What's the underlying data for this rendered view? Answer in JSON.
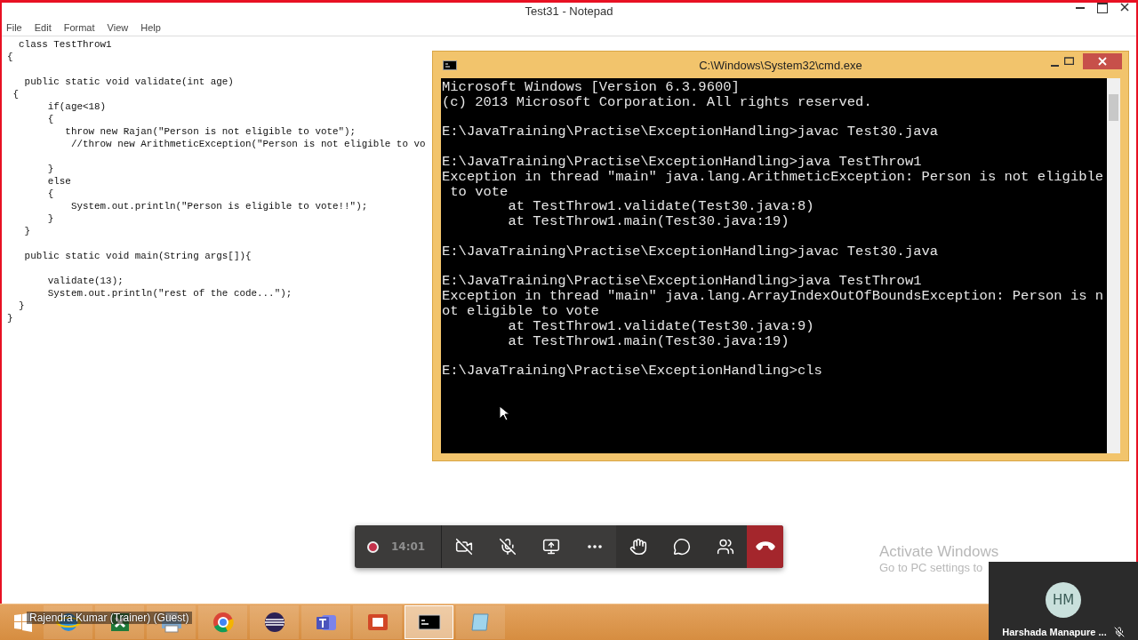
{
  "notepad": {
    "title": "Test31 - Notepad",
    "menu": [
      "File",
      "Edit",
      "Format",
      "View",
      "Help"
    ],
    "text": "  class TestThrow1\n{\n\n   public static void validate(int age)\n {\n       if(age<18)\n       {\n          throw new Rajan(\"Person is not eligible to vote\");\n           //throw new ArithmeticException(\"Person is not eligible to vo\n\n       }\n       else\n       {\n           System.out.println(\"Person is eligible to vote!!\");\n       }\n   }\n\n   public static void main(String args[]){\n\n       validate(13);\n       System.out.println(\"rest of the code...\");\n  }\n}"
  },
  "console": {
    "title": "C:\\Windows\\System32\\cmd.exe",
    "text": "Microsoft Windows [Version 6.3.9600]\n(c) 2013 Microsoft Corporation. All rights reserved.\n\nE:\\JavaTraining\\Practise\\ExceptionHandling>javac Test30.java\n\nE:\\JavaTraining\\Practise\\ExceptionHandling>java TestThrow1\nException in thread \"main\" java.lang.ArithmeticException: Person is not eligible\n to vote\n        at TestThrow1.validate(Test30.java:8)\n        at TestThrow1.main(Test30.java:19)\n\nE:\\JavaTraining\\Practise\\ExceptionHandling>javac Test30.java\n\nE:\\JavaTraining\\Practise\\ExceptionHandling>java TestThrow1\nException in thread \"main\" java.lang.ArrayIndexOutOfBoundsException: Person is n\not eligible to vote\n        at TestThrow1.validate(Test30.java:9)\n        at TestThrow1.main(Test30.java:19)\n\nE:\\JavaTraining\\Practise\\ExceptionHandling>cls"
  },
  "call_bar": {
    "time": "14:01",
    "recording": true,
    "buttons": [
      {
        "kind": "camera-off"
      },
      {
        "kind": "mic-off"
      },
      {
        "kind": "share"
      },
      {
        "kind": "more"
      },
      {
        "kind": "hand"
      },
      {
        "kind": "chat"
      },
      {
        "kind": "people"
      },
      {
        "kind": "hang-up"
      }
    ]
  },
  "activation": {
    "title": "Activate Windows",
    "hint": "Go to PC settings to"
  },
  "participant": {
    "initials": "HM",
    "name": "Harshada Manapure ...",
    "muted": true
  },
  "taskbar": {
    "presenter": "Rajendra Kumar (Trainer) (Guest)",
    "apps": [
      {
        "kind": "browser-e",
        "selected": false
      },
      {
        "kind": "sheet",
        "selected": false
      },
      {
        "kind": "printer",
        "selected": false
      },
      {
        "kind": "chrome",
        "selected": false
      },
      {
        "kind": "eclipse",
        "selected": false
      },
      {
        "kind": "teams",
        "selected": false
      },
      {
        "kind": "slides",
        "selected": false
      },
      {
        "kind": "terminal",
        "selected": true
      },
      {
        "kind": "notepad",
        "selected": false
      }
    ]
  }
}
